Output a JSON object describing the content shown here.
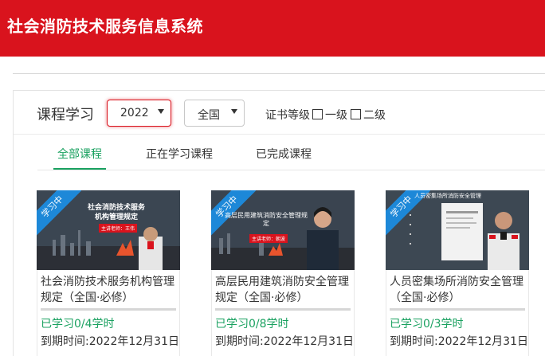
{
  "header": {
    "site_title": "社会消防技术服务信息系统"
  },
  "panel": {
    "title": "课程学习",
    "filters": {
      "year": "2022",
      "region": "全国",
      "grade_label": "证书等级",
      "grade_options": [
        "一级",
        "二级"
      ]
    },
    "tabs": [
      {
        "label": "全部课程",
        "active": true
      },
      {
        "label": "正在学习课程",
        "active": false
      },
      {
        "label": "已完成课程",
        "active": false
      }
    ]
  },
  "courses": [
    {
      "ribbon": "学习中",
      "thumb_title": "社会消防技术服务\n机构管理规定",
      "thumb_sub": "主讲老师：王伟",
      "title": "社会消防技术服务机构管理规定（全国·必修）",
      "progress": 0,
      "studied": "已学习0/4学时",
      "deadline": "到期时间:2022年12月31日"
    },
    {
      "ribbon": "学习中",
      "thumb_title": "高层民用建筑消防安全管理规定",
      "thumb_sub": "主讲老师：朝波",
      "title": "高层民用建筑消防安全管理规定（全国·必修）",
      "progress": 0,
      "studied": "已学习0/8学时",
      "deadline": "到期时间:2022年12月31日"
    },
    {
      "ribbon": "学习中",
      "thumb_title": "人员密集场所消防安全管理",
      "thumb_sub": "",
      "title": "人员密集场所消防安全管理（全国·必修）",
      "progress": 0,
      "studied": "已学习0/3学时",
      "deadline": "到期时间:2022年12月31日"
    }
  ],
  "colors": {
    "brand_red": "#d9131d",
    "accent_green": "#1aa160",
    "ribbon_blue": "#1d88d8"
  }
}
